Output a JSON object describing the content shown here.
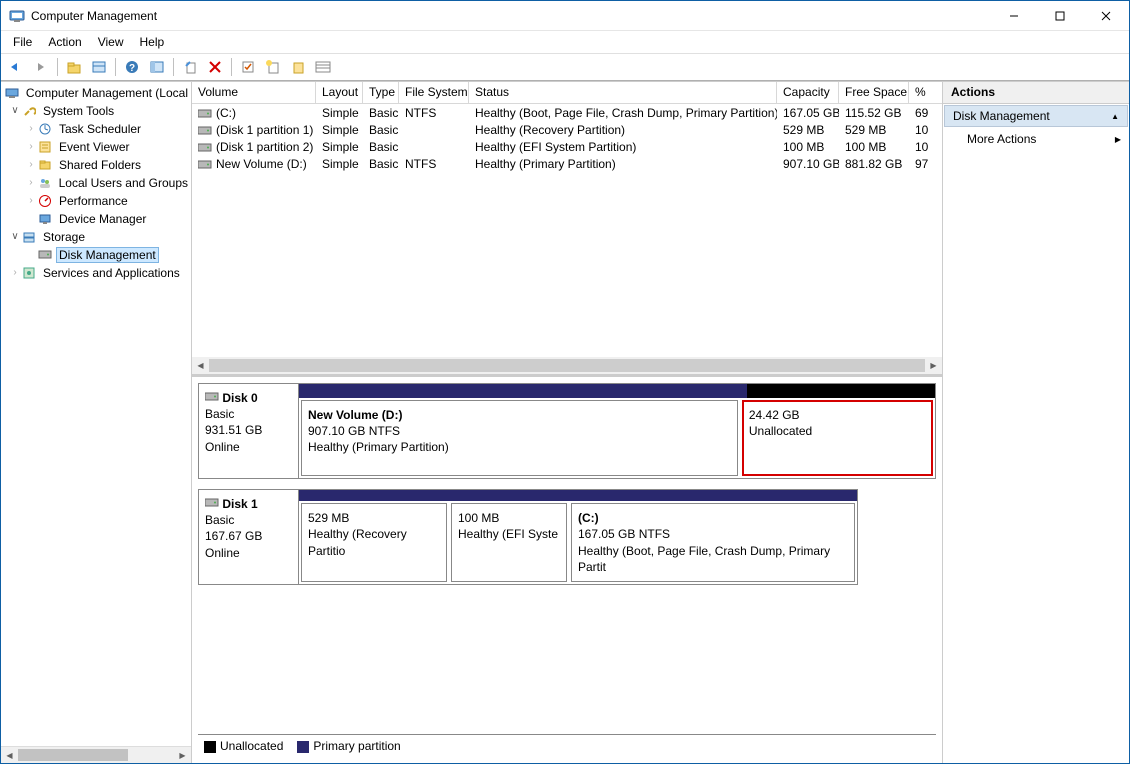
{
  "window": {
    "title": "Computer Management"
  },
  "menu": {
    "file": "File",
    "action": "Action",
    "view": "View",
    "help": "Help"
  },
  "tree": {
    "root": "Computer Management (Local",
    "system_tools": "System Tools",
    "task_scheduler": "Task Scheduler",
    "event_viewer": "Event Viewer",
    "shared_folders": "Shared Folders",
    "local_users": "Local Users and Groups",
    "performance": "Performance",
    "device_manager": "Device Manager",
    "storage": "Storage",
    "disk_management": "Disk Management",
    "services_apps": "Services and Applications"
  },
  "list": {
    "headers": {
      "volume": "Volume",
      "layout": "Layout",
      "type": "Type",
      "fs": "File System",
      "status": "Status",
      "capacity": "Capacity",
      "free": "Free Space",
      "pct": "%"
    },
    "rows": [
      {
        "volume": "(C:)",
        "layout": "Simple",
        "type": "Basic",
        "fs": "NTFS",
        "status": "Healthy (Boot, Page File, Crash Dump, Primary Partition)",
        "capacity": "167.05 GB",
        "free": "115.52 GB",
        "pct": "69"
      },
      {
        "volume": "(Disk 1 partition 1)",
        "layout": "Simple",
        "type": "Basic",
        "fs": "",
        "status": "Healthy (Recovery Partition)",
        "capacity": "529 MB",
        "free": "529 MB",
        "pct": "10"
      },
      {
        "volume": "(Disk 1 partition 2)",
        "layout": "Simple",
        "type": "Basic",
        "fs": "",
        "status": "Healthy (EFI System Partition)",
        "capacity": "100 MB",
        "free": "100 MB",
        "pct": "10"
      },
      {
        "volume": "New Volume (D:)",
        "layout": "Simple",
        "type": "Basic",
        "fs": "NTFS",
        "status": "Healthy (Primary Partition)",
        "capacity": "907.10 GB",
        "free": "881.82 GB",
        "pct": "97"
      }
    ]
  },
  "disks": [
    {
      "name": "Disk 0",
      "type": "Basic",
      "size": "931.51 GB",
      "status": "Online",
      "strip": [
        {
          "cls": "strip-blue",
          "flex": 907.1
        },
        {
          "cls": "strip-black",
          "flex": 380
        }
      ],
      "parts": [
        {
          "title": "New Volume  (D:)",
          "line2": "907.10 GB NTFS",
          "line3": "Healthy (Primary Partition)",
          "flex": 907.1,
          "highlighted": false
        },
        {
          "title": "",
          "line2": "24.42 GB",
          "line3": "Unallocated",
          "flex": 380,
          "highlighted": true
        }
      ]
    },
    {
      "name": "Disk 1",
      "type": "Basic",
      "size": "167.67 GB",
      "status": "Online",
      "strip": [
        {
          "cls": "strip-blue",
          "flex": 1
        }
      ],
      "parts": [
        {
          "title": "",
          "line2": "529 MB",
          "line3": "Healthy (Recovery Partitio",
          "flex": 110,
          "highlighted": false
        },
        {
          "title": "",
          "line2": "100 MB",
          "line3": "Healthy (EFI Syste",
          "flex": 85,
          "highlighted": false
        },
        {
          "title": "(C:)",
          "line2": "167.05 GB NTFS",
          "line3": "Healthy (Boot, Page File, Crash Dump, Primary Partit",
          "flex": 225,
          "highlighted": false
        }
      ],
      "short": true
    }
  ],
  "legend": {
    "unallocated": "Unallocated",
    "primary": "Primary partition"
  },
  "actions": {
    "header": "Actions",
    "section": "Disk Management",
    "more": "More Actions"
  }
}
